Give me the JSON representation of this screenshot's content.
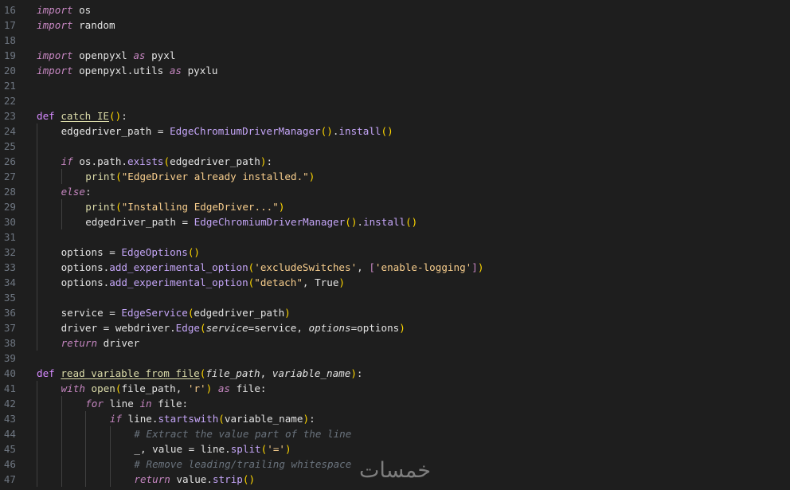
{
  "editor": {
    "lines": [
      {
        "n": "16",
        "indent": 0,
        "tokens": [
          [
            "kwi",
            "import"
          ],
          [
            "",
            " os"
          ]
        ]
      },
      {
        "n": "17",
        "indent": 0,
        "tokens": [
          [
            "kwi",
            "import"
          ],
          [
            "",
            " random"
          ]
        ]
      },
      {
        "n": "18",
        "indent": 0,
        "tokens": []
      },
      {
        "n": "19",
        "indent": 0,
        "tokens": [
          [
            "kwi",
            "import"
          ],
          [
            "",
            " openpyxl "
          ],
          [
            "kwi",
            "as"
          ],
          [
            "",
            " pyxl"
          ]
        ]
      },
      {
        "n": "20",
        "indent": 0,
        "tokens": [
          [
            "kwi",
            "import"
          ],
          [
            "",
            " openpyxl.utils "
          ],
          [
            "kwi",
            "as"
          ],
          [
            "",
            " pyxlu"
          ]
        ]
      },
      {
        "n": "21",
        "indent": 0,
        "tokens": []
      },
      {
        "n": "22",
        "indent": 0,
        "tokens": []
      },
      {
        "n": "23",
        "indent": 0,
        "tokens": [
          [
            "def",
            "def"
          ],
          [
            "",
            " "
          ],
          [
            "fnu",
            "catch_IE"
          ],
          [
            "par",
            "()"
          ],
          [
            "",
            ":"
          ]
        ]
      },
      {
        "n": "24",
        "indent": 1,
        "tokens": [
          [
            "",
            "edgedriver_path = "
          ],
          [
            "fnc",
            "EdgeChromiumDriverManager"
          ],
          [
            "par",
            "()"
          ],
          [
            "",
            "."
          ],
          [
            "mth",
            "install"
          ],
          [
            "par",
            "()"
          ]
        ]
      },
      {
        "n": "25",
        "indent": 1,
        "tokens": []
      },
      {
        "n": "26",
        "indent": 1,
        "tokens": [
          [
            "kwi",
            "if"
          ],
          [
            "",
            " os.path."
          ],
          [
            "mth",
            "exists"
          ],
          [
            "par",
            "("
          ],
          [
            "",
            "edgedriver_path"
          ],
          [
            "par",
            ")"
          ],
          [
            "",
            ":"
          ]
        ]
      },
      {
        "n": "27",
        "indent": 2,
        "tokens": [
          [
            "fn",
            "print"
          ],
          [
            "par",
            "("
          ],
          [
            "str",
            "\"EdgeDriver already installed.\""
          ],
          [
            "par",
            ")"
          ]
        ]
      },
      {
        "n": "28",
        "indent": 1,
        "tokens": [
          [
            "kwi",
            "else"
          ],
          [
            "",
            ":"
          ]
        ]
      },
      {
        "n": "29",
        "indent": 2,
        "tokens": [
          [
            "fn",
            "print"
          ],
          [
            "par",
            "("
          ],
          [
            "str",
            "\"Installing EdgeDriver...\""
          ],
          [
            "par",
            ")"
          ]
        ]
      },
      {
        "n": "30",
        "indent": 2,
        "tokens": [
          [
            "",
            "edgedriver_path = "
          ],
          [
            "fnc",
            "EdgeChromiumDriverManager"
          ],
          [
            "par",
            "()"
          ],
          [
            "",
            "."
          ],
          [
            "mth",
            "install"
          ],
          [
            "par",
            "()"
          ]
        ]
      },
      {
        "n": "31",
        "indent": 1,
        "tokens": []
      },
      {
        "n": "32",
        "indent": 1,
        "tokens": [
          [
            "",
            "options = "
          ],
          [
            "fnc",
            "EdgeOptions"
          ],
          [
            "par",
            "()"
          ]
        ]
      },
      {
        "n": "33",
        "indent": 1,
        "tokens": [
          [
            "",
            "options."
          ],
          [
            "mth",
            "add_experimental_option"
          ],
          [
            "par",
            "("
          ],
          [
            "str",
            "'excludeSwitches'"
          ],
          [
            "",
            ", "
          ],
          [
            "kw",
            "["
          ],
          [
            "str",
            "'enable-logging'"
          ],
          [
            "kw",
            "]"
          ],
          [
            "par",
            ")"
          ]
        ]
      },
      {
        "n": "34",
        "indent": 1,
        "tokens": [
          [
            "",
            "options."
          ],
          [
            "mth",
            "add_experimental_option"
          ],
          [
            "par",
            "("
          ],
          [
            "str",
            "\"detach\""
          ],
          [
            "",
            ", True"
          ],
          [
            "par",
            ")"
          ]
        ]
      },
      {
        "n": "35",
        "indent": 1,
        "tokens": []
      },
      {
        "n": "36",
        "indent": 1,
        "tokens": [
          [
            "",
            "service = "
          ],
          [
            "fnc",
            "EdgeService"
          ],
          [
            "par",
            "("
          ],
          [
            "",
            "edgedriver_path"
          ],
          [
            "par",
            ")"
          ]
        ]
      },
      {
        "n": "37",
        "indent": 1,
        "tokens": [
          [
            "",
            "driver = webdriver."
          ],
          [
            "fnc",
            "Edge"
          ],
          [
            "par",
            "("
          ],
          [
            "prm",
            "service"
          ],
          [
            "",
            "=service, "
          ],
          [
            "prm",
            "options"
          ],
          [
            "",
            "=options"
          ],
          [
            "par",
            ")"
          ]
        ]
      },
      {
        "n": "38",
        "indent": 1,
        "tokens": [
          [
            "kwi",
            "return"
          ],
          [
            "",
            " driver"
          ]
        ]
      },
      {
        "n": "39",
        "indent": 0,
        "tokens": []
      },
      {
        "n": "40",
        "indent": 0,
        "tokens": [
          [
            "def",
            "def"
          ],
          [
            "",
            " "
          ],
          [
            "fnu",
            "read_variable_from_file"
          ],
          [
            "par",
            "("
          ],
          [
            "prm",
            "file_path"
          ],
          [
            "",
            ", "
          ],
          [
            "prm",
            "variable_name"
          ],
          [
            "par",
            ")"
          ],
          [
            "",
            ":"
          ]
        ]
      },
      {
        "n": "41",
        "indent": 1,
        "tokens": [
          [
            "kwi",
            "with"
          ],
          [
            "",
            " "
          ],
          [
            "fn",
            "open"
          ],
          [
            "par",
            "("
          ],
          [
            "",
            "file_path, "
          ],
          [
            "str",
            "'r'"
          ],
          [
            "par",
            ")"
          ],
          [
            "",
            " "
          ],
          [
            "kwi",
            "as"
          ],
          [
            "",
            " file:"
          ]
        ]
      },
      {
        "n": "42",
        "indent": 2,
        "tokens": [
          [
            "kwi",
            "for"
          ],
          [
            "",
            " line "
          ],
          [
            "kwi",
            "in"
          ],
          [
            "",
            " file:"
          ]
        ]
      },
      {
        "n": "43",
        "indent": 3,
        "tokens": [
          [
            "kwi",
            "if"
          ],
          [
            "",
            " line."
          ],
          [
            "mth",
            "startswith"
          ],
          [
            "par",
            "("
          ],
          [
            "",
            "variable_name"
          ],
          [
            "par",
            ")"
          ],
          [
            "",
            ":"
          ]
        ]
      },
      {
        "n": "44",
        "indent": 4,
        "tokens": [
          [
            "cm",
            "# Extract the value part of the line"
          ]
        ]
      },
      {
        "n": "45",
        "indent": 4,
        "tokens": [
          [
            "",
            "_, value = line."
          ],
          [
            "mth",
            "split"
          ],
          [
            "par",
            "("
          ],
          [
            "str",
            "'='"
          ],
          [
            "par",
            ")"
          ]
        ]
      },
      {
        "n": "46",
        "indent": 4,
        "tokens": [
          [
            "cm",
            "# Remove leading/trailing whitespace"
          ]
        ]
      },
      {
        "n": "47",
        "indent": 4,
        "tokens": [
          [
            "kwi",
            "return"
          ],
          [
            "",
            " value."
          ],
          [
            "mth",
            "strip"
          ],
          [
            "par",
            "()"
          ]
        ]
      }
    ]
  },
  "watermark": {
    "text": "خمسات",
    "color": "#8f8f8f"
  },
  "colors": {
    "background": "#1e1e1e",
    "line_number": "#6e7681",
    "text": "#e2e2e2",
    "keyword": "#c586c0",
    "function": "#dcdcaa",
    "class_call": "#c4a5f7",
    "string": "#f7cd8c",
    "comment": "#6a737d",
    "bracket": "#ffd700"
  }
}
